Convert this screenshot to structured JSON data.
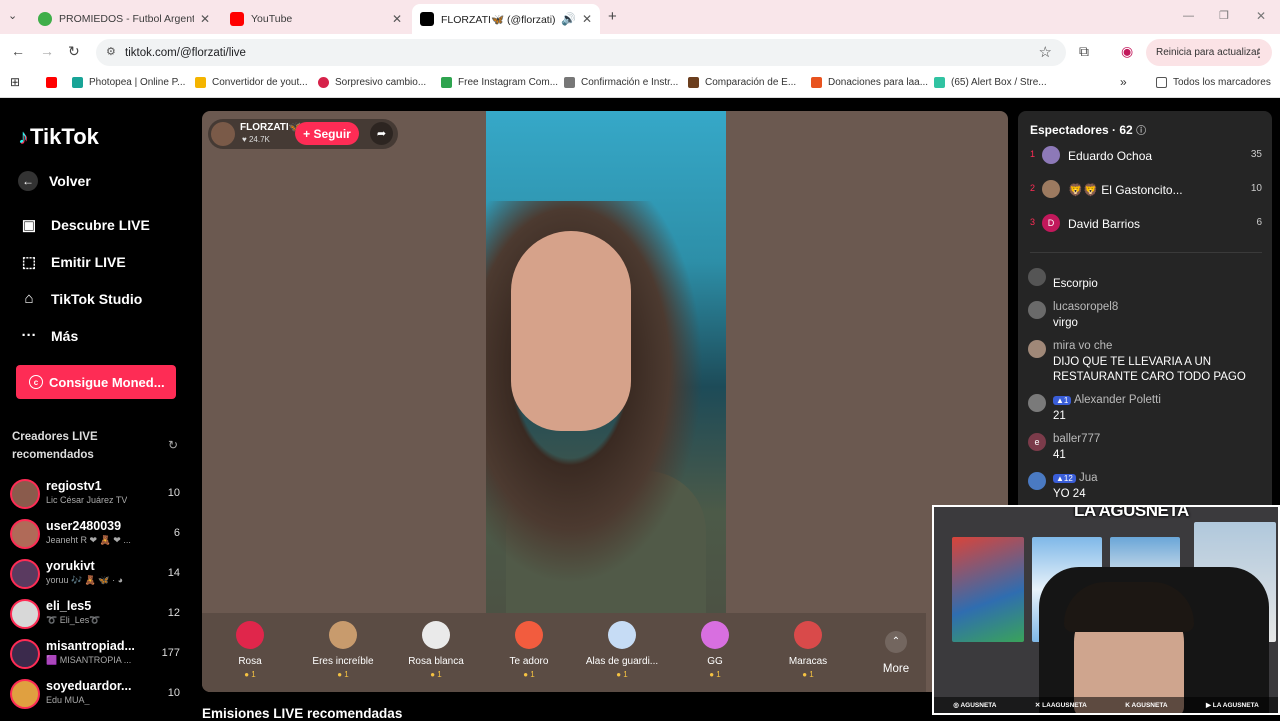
{
  "browser": {
    "tabs": [
      {
        "title": "PROMIEDOS - Futbol Argentino",
        "favicon_color": "#3fae49"
      },
      {
        "title": "YouTube",
        "favicon_color": "#ff0000"
      },
      {
        "title": "FLORZATI🦋 (@florzati) está",
        "favicon_color": "#000000"
      }
    ],
    "url": "tiktok.com/@florzati/live",
    "update_button": "Reinicia para actualizar",
    "bookmarks": [
      {
        "label": "Photopea | Online P...",
        "color": "#18a497"
      },
      {
        "label": "Convertidor de yout...",
        "color": "#f4b400"
      },
      {
        "label": "Sorpresivo cambio...",
        "color": "#d6224a"
      },
      {
        "label": "Free Instagram Com...",
        "color": "#2ea44f"
      },
      {
        "label": "Confirmación e Instr...",
        "color": "#777777"
      },
      {
        "label": "Comparación de E...",
        "color": "#6b3e1e"
      },
      {
        "label": "Donaciones para laa...",
        "color": "#e8531f"
      },
      {
        "label": "(65) Alert Box / Stre...",
        "color": "#31c3a2"
      }
    ],
    "all_bookmarks": "Todos los marcadores"
  },
  "sidebar": {
    "logo": "TikTok",
    "nav": [
      {
        "label": "Volver",
        "icon": "←"
      },
      {
        "label": "Descubre LIVE",
        "icon": "▣"
      },
      {
        "label": "Emitir LIVE",
        "icon": "⬚"
      },
      {
        "label": "TikTok Studio",
        "icon": "⌂"
      },
      {
        "label": "Más",
        "icon": "···"
      }
    ],
    "coins_button": "Consigue Moned...",
    "creators_title": "Creadores LIVE recomendados",
    "creators": [
      {
        "name": "regiostv1",
        "sub": "Lic César Juárez TV",
        "count": "10",
        "color": "#8a5b4c"
      },
      {
        "name": "user2480039",
        "sub": "Jeaneht R ❤ 🧸 ❤ ...",
        "count": "6",
        "color": "#b06a58"
      },
      {
        "name": "yorukivt",
        "sub": "yoruu 🎶 🧸 🦋 · ◕",
        "count": "14",
        "color": "#5a3a60"
      },
      {
        "name": "eli_les5",
        "sub": "➰ Eli_Les➰",
        "count": "12",
        "color": "#d8d8d8"
      },
      {
        "name": "misantropiad...",
        "sub": "🟪 MISANTROPIA ...",
        "count": "177",
        "color": "#3b2a4c"
      },
      {
        "name": "soyeduardor...",
        "sub": "Edu MUA_",
        "count": "10",
        "color": "#e0a040"
      }
    ]
  },
  "stream": {
    "host_name": "FLORZATI🦋",
    "host_likes": "♥ 24.7K",
    "follow_label": "+ Seguir",
    "share_icon": "➦",
    "gifts": [
      {
        "name": "Rosa",
        "price": "1",
        "color": "#e0264b"
      },
      {
        "name": "Eres increíble",
        "price": "1",
        "color": "#c89b6d"
      },
      {
        "name": "Rosa blanca",
        "price": "1",
        "color": "#eaeaea"
      },
      {
        "name": "Te adoro",
        "price": "1",
        "color": "#f25c3e"
      },
      {
        "name": "Alas de guardi...",
        "price": "1",
        "color": "#c6dcf5"
      },
      {
        "name": "GG",
        "price": "1",
        "color": "#d86fe0"
      },
      {
        "name": "Maracas",
        "price": "1",
        "color": "#d94a4a"
      }
    ],
    "more_label": "More",
    "recommended_title": "Emisiones LIVE recomendadas"
  },
  "chat": {
    "viewers_label": "Espectadores · 62",
    "top_viewers": [
      {
        "rank": "1",
        "name": "Eduardo Ochoa",
        "score": "35",
        "color": "#8d79b8"
      },
      {
        "rank": "2",
        "name": "🦁🦁 El Gastoncito...",
        "score": "10",
        "color": "#9c7a60"
      },
      {
        "rank": "3",
        "name": "David Barrios",
        "score": "6",
        "color": "#c2185b"
      }
    ],
    "messages": [
      {
        "user": "",
        "text": "Escorpio",
        "color": "#555555"
      },
      {
        "user": "lucasoropel8",
        "text": "virgo",
        "color": "#6a6a6a"
      },
      {
        "user": "mira vo che",
        "text": "DIJO QUE TE LLEVARIA A UN RESTAURANTE CARO TODO PAGO",
        "color": "#a08878"
      },
      {
        "user": "Alexander Poletti",
        "text": "21",
        "color": "#7a7a7a"
      },
      {
        "user": "baller777",
        "text": "41",
        "color": "#7b3b4a"
      },
      {
        "user": "Jua",
        "text": "YO 24",
        "color": "#4a7ac2"
      }
    ]
  },
  "webcam": {
    "logo_text": "LA AGUSNETA",
    "socials": [
      "AGUSNETA",
      "LAAGUSNETA",
      "AGUSNETA",
      "LA AGUSNETA"
    ]
  }
}
